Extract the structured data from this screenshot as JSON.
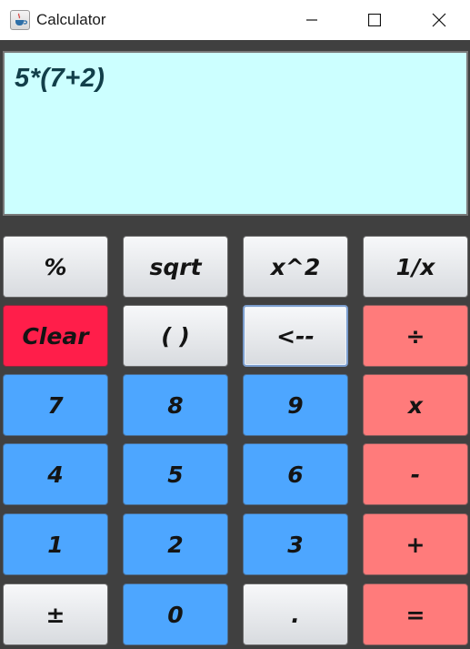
{
  "window": {
    "title": "Calculator",
    "app_icon": "java-cup-icon",
    "controls": [
      "minimize-icon",
      "maximize-icon",
      "close-icon"
    ]
  },
  "display": {
    "expression": "5*(7+2)",
    "background": "#ccffff"
  },
  "keypad": {
    "rows": [
      [
        {
          "name": "percent-button",
          "label": "%",
          "style": "gray"
        },
        {
          "name": "sqrt-button",
          "label": "sqrt",
          "style": "gray"
        },
        {
          "name": "square-button",
          "label": "x^2",
          "style": "gray"
        },
        {
          "name": "reciprocal-button",
          "label": "1/x",
          "style": "gray"
        }
      ],
      [
        {
          "name": "clear-button",
          "label": "Clear",
          "style": "clear"
        },
        {
          "name": "parentheses-button",
          "label": "( )",
          "style": "gray"
        },
        {
          "name": "backspace-button",
          "label": "<--",
          "style": "gray focused"
        },
        {
          "name": "divide-button",
          "label": "÷",
          "style": "red"
        }
      ],
      [
        {
          "name": "digit-7-button",
          "label": "7",
          "style": "blue"
        },
        {
          "name": "digit-8-button",
          "label": "8",
          "style": "blue"
        },
        {
          "name": "digit-9-button",
          "label": "9",
          "style": "blue"
        },
        {
          "name": "multiply-button",
          "label": "x",
          "style": "red"
        }
      ],
      [
        {
          "name": "digit-4-button",
          "label": "4",
          "style": "blue"
        },
        {
          "name": "digit-5-button",
          "label": "5",
          "style": "blue"
        },
        {
          "name": "digit-6-button",
          "label": "6",
          "style": "blue"
        },
        {
          "name": "subtract-button",
          "label": "-",
          "style": "red"
        }
      ],
      [
        {
          "name": "digit-1-button",
          "label": "1",
          "style": "blue"
        },
        {
          "name": "digit-2-button",
          "label": "2",
          "style": "blue"
        },
        {
          "name": "digit-3-button",
          "label": "3",
          "style": "blue"
        },
        {
          "name": "add-button",
          "label": "+",
          "style": "red"
        }
      ],
      [
        {
          "name": "plus-minus-button",
          "label": "±",
          "style": "gray"
        },
        {
          "name": "digit-0-button",
          "label": "0",
          "style": "blue"
        },
        {
          "name": "decimal-point-button",
          "label": ".",
          "style": "gray"
        },
        {
          "name": "equals-button",
          "label": "=",
          "style": "red"
        }
      ]
    ]
  },
  "colors": {
    "panel": "#404040",
    "digit_key": "#4da6ff",
    "operator_key": "#ff7b7b",
    "clear_key": "#ff1e4a",
    "function_key": "#e6e8eb"
  }
}
